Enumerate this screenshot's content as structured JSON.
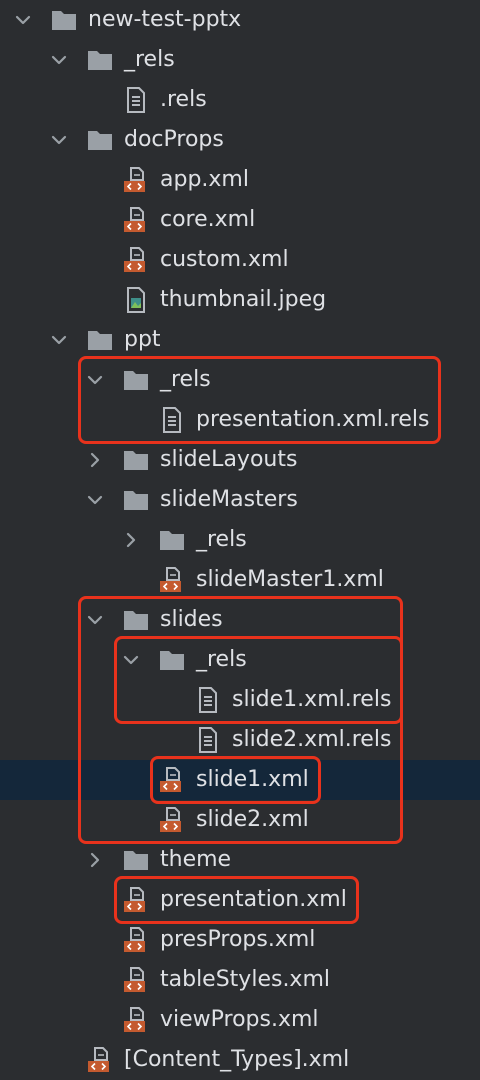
{
  "tree": [
    {
      "label": "new-test-pptx",
      "kind": "folder",
      "state": "expanded",
      "depth": 0
    },
    {
      "label": "_rels",
      "kind": "folder",
      "state": "expanded",
      "depth": 1
    },
    {
      "label": ".rels",
      "kind": "text-file",
      "depth": 2
    },
    {
      "label": "docProps",
      "kind": "folder",
      "state": "expanded",
      "depth": 1
    },
    {
      "label": "app.xml",
      "kind": "xml-file",
      "depth": 2
    },
    {
      "label": "core.xml",
      "kind": "xml-file",
      "depth": 2
    },
    {
      "label": "custom.xml",
      "kind": "xml-file",
      "depth": 2
    },
    {
      "label": "thumbnail.jpeg",
      "kind": "image-file",
      "depth": 2
    },
    {
      "label": "ppt",
      "kind": "folder",
      "state": "expanded",
      "depth": 1
    },
    {
      "label": "_rels",
      "kind": "folder",
      "state": "expanded",
      "depth": 2
    },
    {
      "label": "presentation.xml.rels",
      "kind": "text-file",
      "depth": 3
    },
    {
      "label": "slideLayouts",
      "kind": "folder",
      "state": "collapsed",
      "depth": 2
    },
    {
      "label": "slideMasters",
      "kind": "folder",
      "state": "expanded",
      "depth": 2
    },
    {
      "label": "_rels",
      "kind": "folder",
      "state": "collapsed",
      "depth": 3
    },
    {
      "label": "slideMaster1.xml",
      "kind": "xml-file",
      "depth": 3
    },
    {
      "label": "slides",
      "kind": "folder",
      "state": "expanded",
      "depth": 2
    },
    {
      "label": "_rels",
      "kind": "folder",
      "state": "expanded",
      "depth": 3
    },
    {
      "label": "slide1.xml.rels",
      "kind": "text-file",
      "depth": 4
    },
    {
      "label": "slide2.xml.rels",
      "kind": "text-file",
      "depth": 4
    },
    {
      "label": "slide1.xml",
      "kind": "xml-file",
      "depth": 3,
      "selected": true
    },
    {
      "label": "slide2.xml",
      "kind": "xml-file",
      "depth": 3
    },
    {
      "label": "theme",
      "kind": "folder",
      "state": "collapsed",
      "depth": 2
    },
    {
      "label": "presentation.xml",
      "kind": "xml-file",
      "depth": 2
    },
    {
      "label": "presProps.xml",
      "kind": "xml-file",
      "depth": 2
    },
    {
      "label": "tableStyles.xml",
      "kind": "xml-file",
      "depth": 2
    },
    {
      "label": "viewProps.xml",
      "kind": "xml-file",
      "depth": 2
    },
    {
      "label": "[Content_Types].xml",
      "kind": "xml-file",
      "depth": 1
    }
  ],
  "highlight_groups": [
    {
      "name": "highlight-ppt-rels",
      "rows": [
        9,
        10
      ]
    },
    {
      "name": "highlight-slides",
      "rows": [
        15,
        20
      ]
    },
    {
      "name": "highlight-slides-rels",
      "rows": [
        16,
        17
      ]
    },
    {
      "name": "highlight-slide1-xml",
      "rows": [
        19,
        19
      ]
    },
    {
      "name": "highlight-presentation-xml",
      "rows": [
        22,
        22
      ]
    }
  ],
  "colors": {
    "background": "#2b2d30",
    "text": "#dfe1e5",
    "folder": "#9aa0a6",
    "file_doc": "#b6bac0",
    "xml_badge": "#c45a2f",
    "selection": "#14273a",
    "highlight": "#e8321c"
  }
}
